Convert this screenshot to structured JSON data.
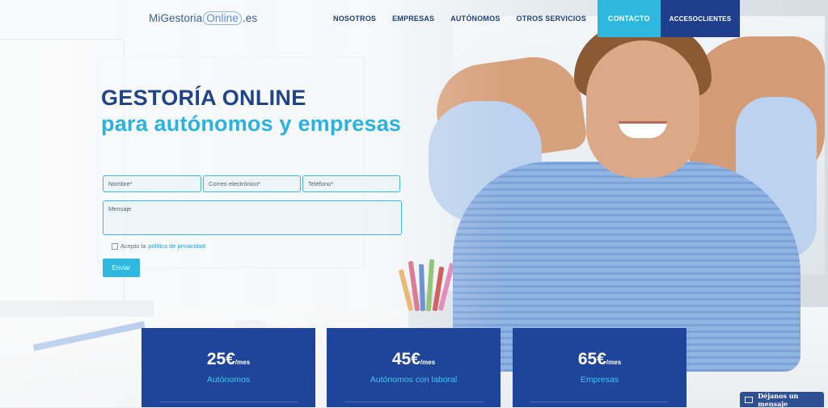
{
  "brand": {
    "logo_part1": "MiGestoria",
    "logo_part2": "Online",
    "logo_part3": ".es"
  },
  "nav": {
    "items": [
      "NOSOTROS",
      "EMPRESAS",
      "AUTÓNOMOS",
      "OTROS SERVICIOS"
    ],
    "contact": "CONTACTO",
    "access": "ACCESOCLIENTES"
  },
  "hero": {
    "title": "GESTORÍA ONLINE",
    "subtitle": "para autónomos y empresas"
  },
  "form": {
    "name_placeholder": "Nombre*",
    "email_placeholder": "Correo electrónico*",
    "phone_placeholder": "Teléfono*",
    "message_placeholder": "Mensaje",
    "privacy_prefix": "Acepto la",
    "privacy_link": "política de privacidad",
    "privacy_checked": false,
    "submit": "Enviar"
  },
  "pricing": [
    {
      "amount": "25€",
      "unit": "/mes",
      "label": "Autónomos"
    },
    {
      "amount": "45€",
      "unit": "/mes",
      "label": "Autónomos con laboral"
    },
    {
      "amount": "65€",
      "unit": "/mes",
      "label": "Empresas"
    }
  ],
  "chat": {
    "label": "Déjanos un mensaje",
    "icon": "envelope-icon"
  },
  "colors": {
    "primary": "#1f459b",
    "accent": "#2eb7df",
    "heading": "#1f4587"
  }
}
